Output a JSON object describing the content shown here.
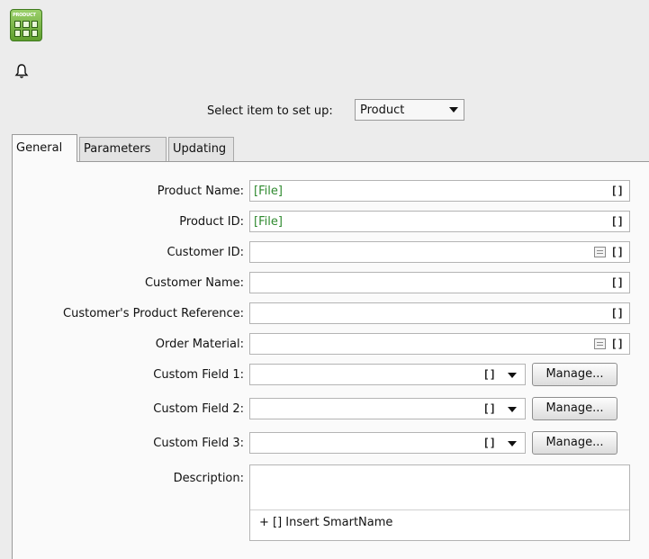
{
  "header": {
    "icon_badge": "PRODUCT",
    "icons": [
      "product-grid-icon",
      "bell-icon"
    ]
  },
  "selector": {
    "label": "Select item to set up:",
    "value": "Product"
  },
  "tabs": [
    {
      "label": "General",
      "active": true
    },
    {
      "label": "Parameters",
      "active": false
    },
    {
      "label": "Updating",
      "active": false
    }
  ],
  "form": {
    "product_name": {
      "label": "Product Name:",
      "value": "[File]",
      "smartname": "[]"
    },
    "product_id": {
      "label": "Product ID:",
      "value": "[File]",
      "smartname": "[]"
    },
    "customer_id": {
      "label": "Customer ID:",
      "value": "",
      "smartname": "[]"
    },
    "customer_name": {
      "label": "Customer Name:",
      "value": "",
      "smartname": "[]"
    },
    "customer_product_ref": {
      "label": "Customer's Product Reference:",
      "value": "",
      "smartname": "[]"
    },
    "order_material": {
      "label": "Order Material:",
      "value": "",
      "smartname": "[]"
    },
    "custom_field_1": {
      "label": "Custom Field 1:",
      "value": "",
      "smartname": "[]",
      "button": "Manage..."
    },
    "custom_field_2": {
      "label": "Custom Field 2:",
      "value": "",
      "smartname": "[]",
      "button": "Manage..."
    },
    "custom_field_3": {
      "label": "Custom Field 3:",
      "value": "",
      "smartname": "[]",
      "button": "Manage..."
    },
    "description": {
      "label": "Description:",
      "value": "",
      "insert_label": "+ [] Insert SmartName"
    }
  },
  "colors": {
    "smartname_value": "#2f8a2f",
    "panel": "#fafafa",
    "window": "#ececec"
  }
}
